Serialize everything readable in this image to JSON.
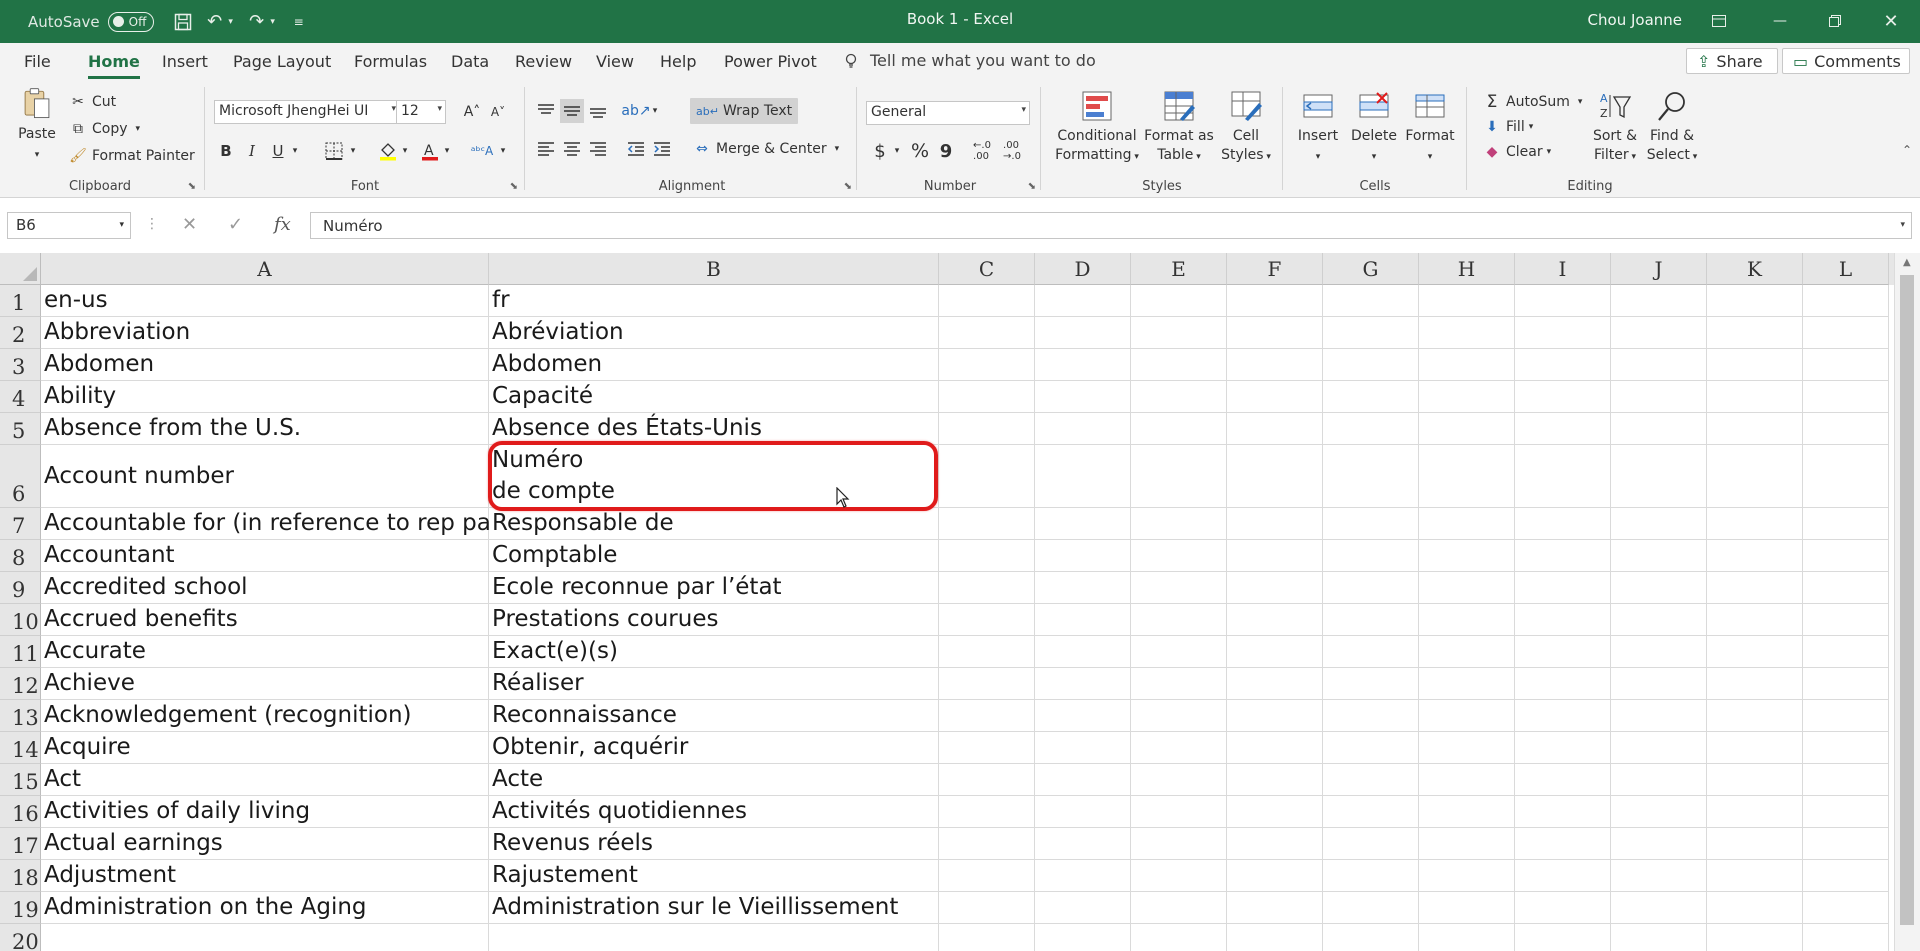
{
  "titlebar": {
    "autosave_label": "AutoSave",
    "autosave_state": "Off",
    "doc_title": "Book 1  -  Excel",
    "user_name": "Chou Joanne"
  },
  "menu": {
    "tabs": [
      "File",
      "Home",
      "Insert",
      "Page Layout",
      "Formulas",
      "Data",
      "Review",
      "View",
      "Help",
      "Power Pivot"
    ],
    "active_tab": "Home",
    "tell_me": "Tell me what you want to do",
    "share": "Share",
    "comments": "Comments"
  },
  "ribbon": {
    "clipboard": {
      "label": "Clipboard",
      "paste": "Paste",
      "cut": "Cut",
      "copy": "Copy",
      "format_painter": "Format Painter"
    },
    "font": {
      "label": "Font",
      "font_name": "Microsoft JhengHei UI",
      "font_size": "12",
      "bold": "B",
      "italic": "I",
      "underline": "U"
    },
    "alignment": {
      "label": "Alignment",
      "wrap_text": "Wrap Text",
      "merge_center": "Merge & Center"
    },
    "number": {
      "label": "Number",
      "format": "General",
      "currency": "$",
      "percent": "%",
      "comma": "9"
    },
    "styles": {
      "label": "Styles",
      "conditional": [
        "Conditional",
        "Formatting"
      ],
      "format_table": [
        "Format as",
        "Table"
      ],
      "cell_styles": [
        "Cell",
        "Styles"
      ]
    },
    "cells": {
      "label": "Cells",
      "insert": "Insert",
      "delete": "Delete",
      "format": "Format"
    },
    "editing": {
      "label": "Editing",
      "autosum": "AutoSum",
      "fill": "Fill",
      "clear": "Clear",
      "sort_filter": [
        "Sort &",
        "Filter"
      ],
      "find_select": [
        "Find &",
        "Select"
      ]
    }
  },
  "formula_bar": {
    "name_box": "B6",
    "formula": "Numéro"
  },
  "sheet": {
    "columns": [
      "A",
      "B",
      "C",
      "D",
      "E",
      "F",
      "G",
      "H",
      "I",
      "J",
      "K",
      "L"
    ],
    "rows": [
      {
        "num": "1",
        "a": "en-us",
        "b": "fr"
      },
      {
        "num": "2",
        "a": "Abbreviation",
        "b": "Abréviation"
      },
      {
        "num": "3",
        "a": "Abdomen",
        "b": "Abdomen"
      },
      {
        "num": "4",
        "a": "Ability",
        "b": "Capacité"
      },
      {
        "num": "5",
        "a": "Absence from the U.S.",
        "b": "Absence des États-Unis"
      },
      {
        "num": "6",
        "a": "Account number",
        "b": "Numéro\nde compte"
      },
      {
        "num": "7",
        "a": "Accountable for (in reference to rep payee)",
        "b": "Responsable de"
      },
      {
        "num": "8",
        "a": "Accountant",
        "b": "Comptable"
      },
      {
        "num": "9",
        "a": "Accredited school",
        "b": "Ecole reconnue par l’état"
      },
      {
        "num": "10",
        "a": "Accrued benefits",
        "b": "Prestations courues"
      },
      {
        "num": "11",
        "a": "Accurate",
        "b": "Exact(e)(s)"
      },
      {
        "num": "12",
        "a": "Achieve",
        "b": "Réaliser"
      },
      {
        "num": "13",
        "a": "Acknowledgement (recognition)",
        "b": "Reconnaissance"
      },
      {
        "num": "14",
        "a": "Acquire",
        "b": "Obtenir, acquérir"
      },
      {
        "num": "15",
        "a": "Act",
        "b": "Acte"
      },
      {
        "num": "16",
        "a": "Activities of daily living",
        "b": "Activités quotidiennes"
      },
      {
        "num": "17",
        "a": "Actual earnings",
        "b": "Revenus réels"
      },
      {
        "num": "18",
        "a": "Adjustment",
        "b": "Rajustement"
      },
      {
        "num": "19",
        "a": "Administration on the Aging",
        "b": "Administration sur le Vieillissement"
      },
      {
        "num": "20",
        "a": "",
        "b": ""
      }
    ]
  },
  "colors": {
    "accent": "#217346",
    "highlight": "#e01b1b"
  }
}
